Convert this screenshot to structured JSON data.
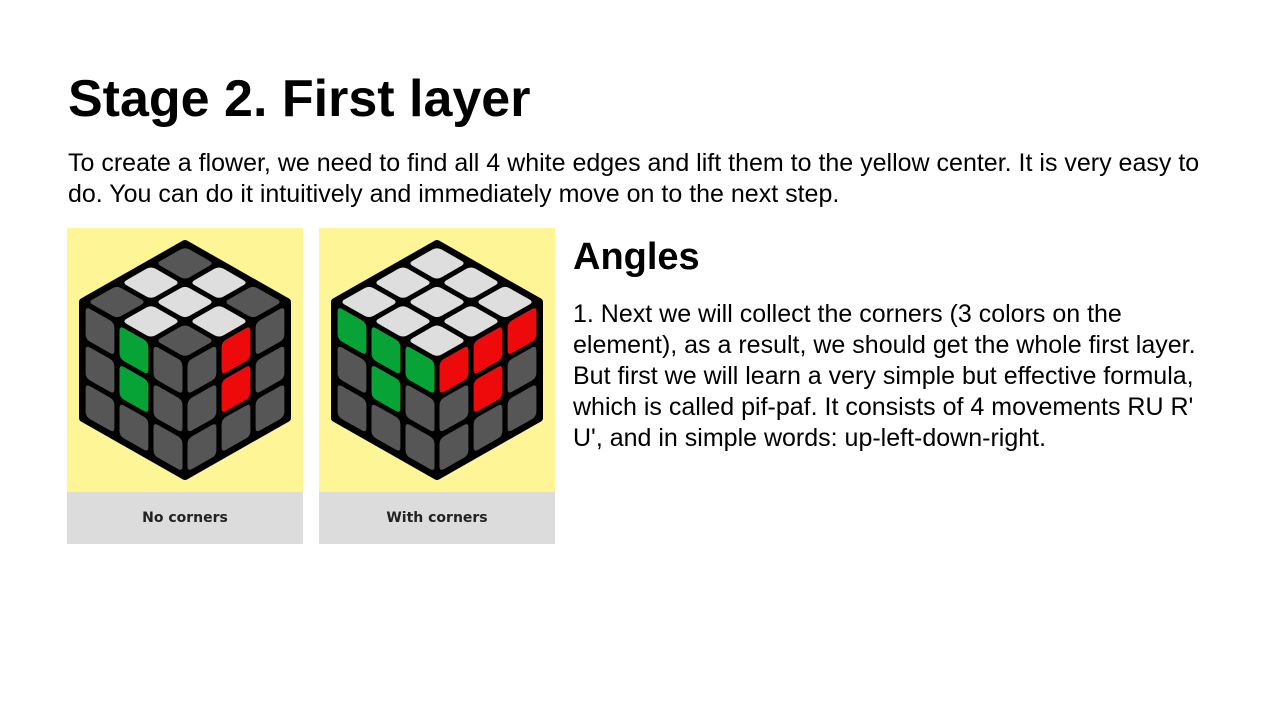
{
  "page": {
    "title": "Stage 2. First layer",
    "intro": "To create a flower, we need to find all 4 white edges and lift them to the yellow center. It is very easy to do. You can do it intuitively and immediately move on to the next step."
  },
  "figures": [
    {
      "caption": "No corners",
      "top": [
        "dark",
        "white",
        "dark",
        "white",
        "white",
        "white",
        "dark",
        "white",
        "dark"
      ],
      "left": [
        "dark",
        "green",
        "dark",
        "dark",
        "green",
        "dark",
        "dark",
        "dark",
        "dark"
      ],
      "right": [
        "dark",
        "red",
        "dark",
        "dark",
        "red",
        "dark",
        "dark",
        "dark",
        "dark"
      ]
    },
    {
      "caption": "With corners",
      "top": [
        "white",
        "white",
        "white",
        "white",
        "white",
        "white",
        "white",
        "white",
        "white"
      ],
      "left": [
        "green",
        "green",
        "green",
        "dark",
        "green",
        "dark",
        "dark",
        "dark",
        "dark"
      ],
      "right": [
        "red",
        "red",
        "red",
        "dark",
        "red",
        "dark",
        "dark",
        "dark",
        "dark"
      ]
    }
  ],
  "colors": {
    "white": "#dedede",
    "dark": "#565656",
    "green": "#08a336",
    "red": "#ee0a0a",
    "outline": "#000000",
    "figure_bg": "#fef597",
    "caption_bg": "#dcdcdc"
  },
  "section": {
    "heading": "Angles",
    "text": "1. Next we will collect the corners (3 colors on the element), as a result, we should get the whole first layer. But first we will learn a very simple but effective formula, which is called pif-paf. It consists of 4 movements RU R' U', and in simple words: up-left-down-right."
  }
}
